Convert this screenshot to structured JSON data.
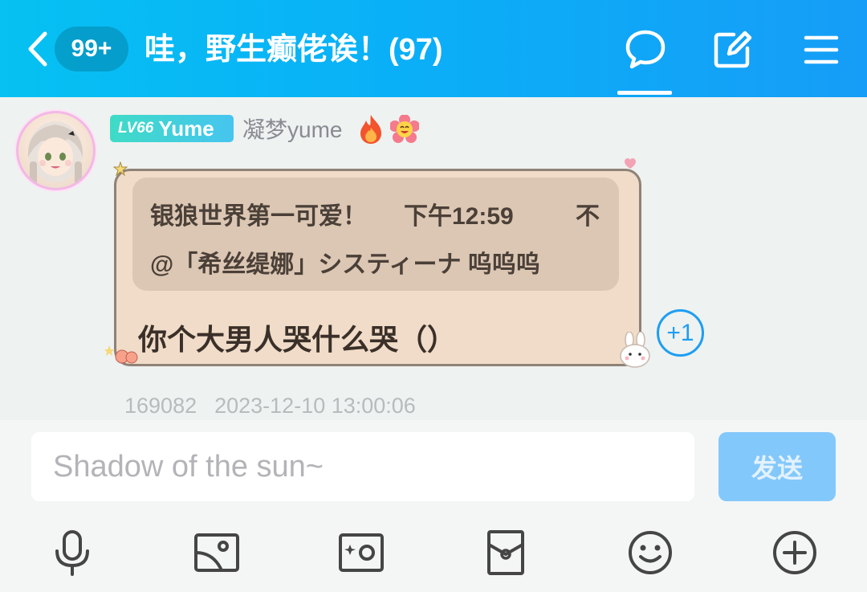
{
  "header": {
    "unread_badge": "99+",
    "title": "哇，野生癫佬诶！(97)",
    "icons": [
      "chevron-left-icon",
      "chat-bubble-icon",
      "edit-icon",
      "menu-icon"
    ]
  },
  "message": {
    "level": "LV66",
    "level_name": "Yume",
    "username": "凝梦yume",
    "badges": [
      "fire-icon",
      "smiley-flower-icon"
    ],
    "quote": {
      "author": "银狼世界第一可爱！",
      "time": "下午12:59",
      "more": "不",
      "text": "@「希丝缇娜」システィーナ 呜呜呜"
    },
    "text": "你个大男人哭什么哭（）",
    "plus_one": "+1",
    "id": "169082",
    "timestamp": "2023-12-10 13:00:06"
  },
  "composer": {
    "placeholder": "Shadow of the sun~",
    "send_label": "发送",
    "tools": [
      "microphone-icon",
      "image-icon",
      "camera-icon",
      "red-packet-icon",
      "emoji-icon",
      "add-icon"
    ]
  },
  "colors": {
    "header_start": "#06c1f2",
    "header_end": "#169df7",
    "bubble": "#f0dcc8",
    "accent": "#1e9ef2",
    "send_button": "#83c8fb"
  }
}
